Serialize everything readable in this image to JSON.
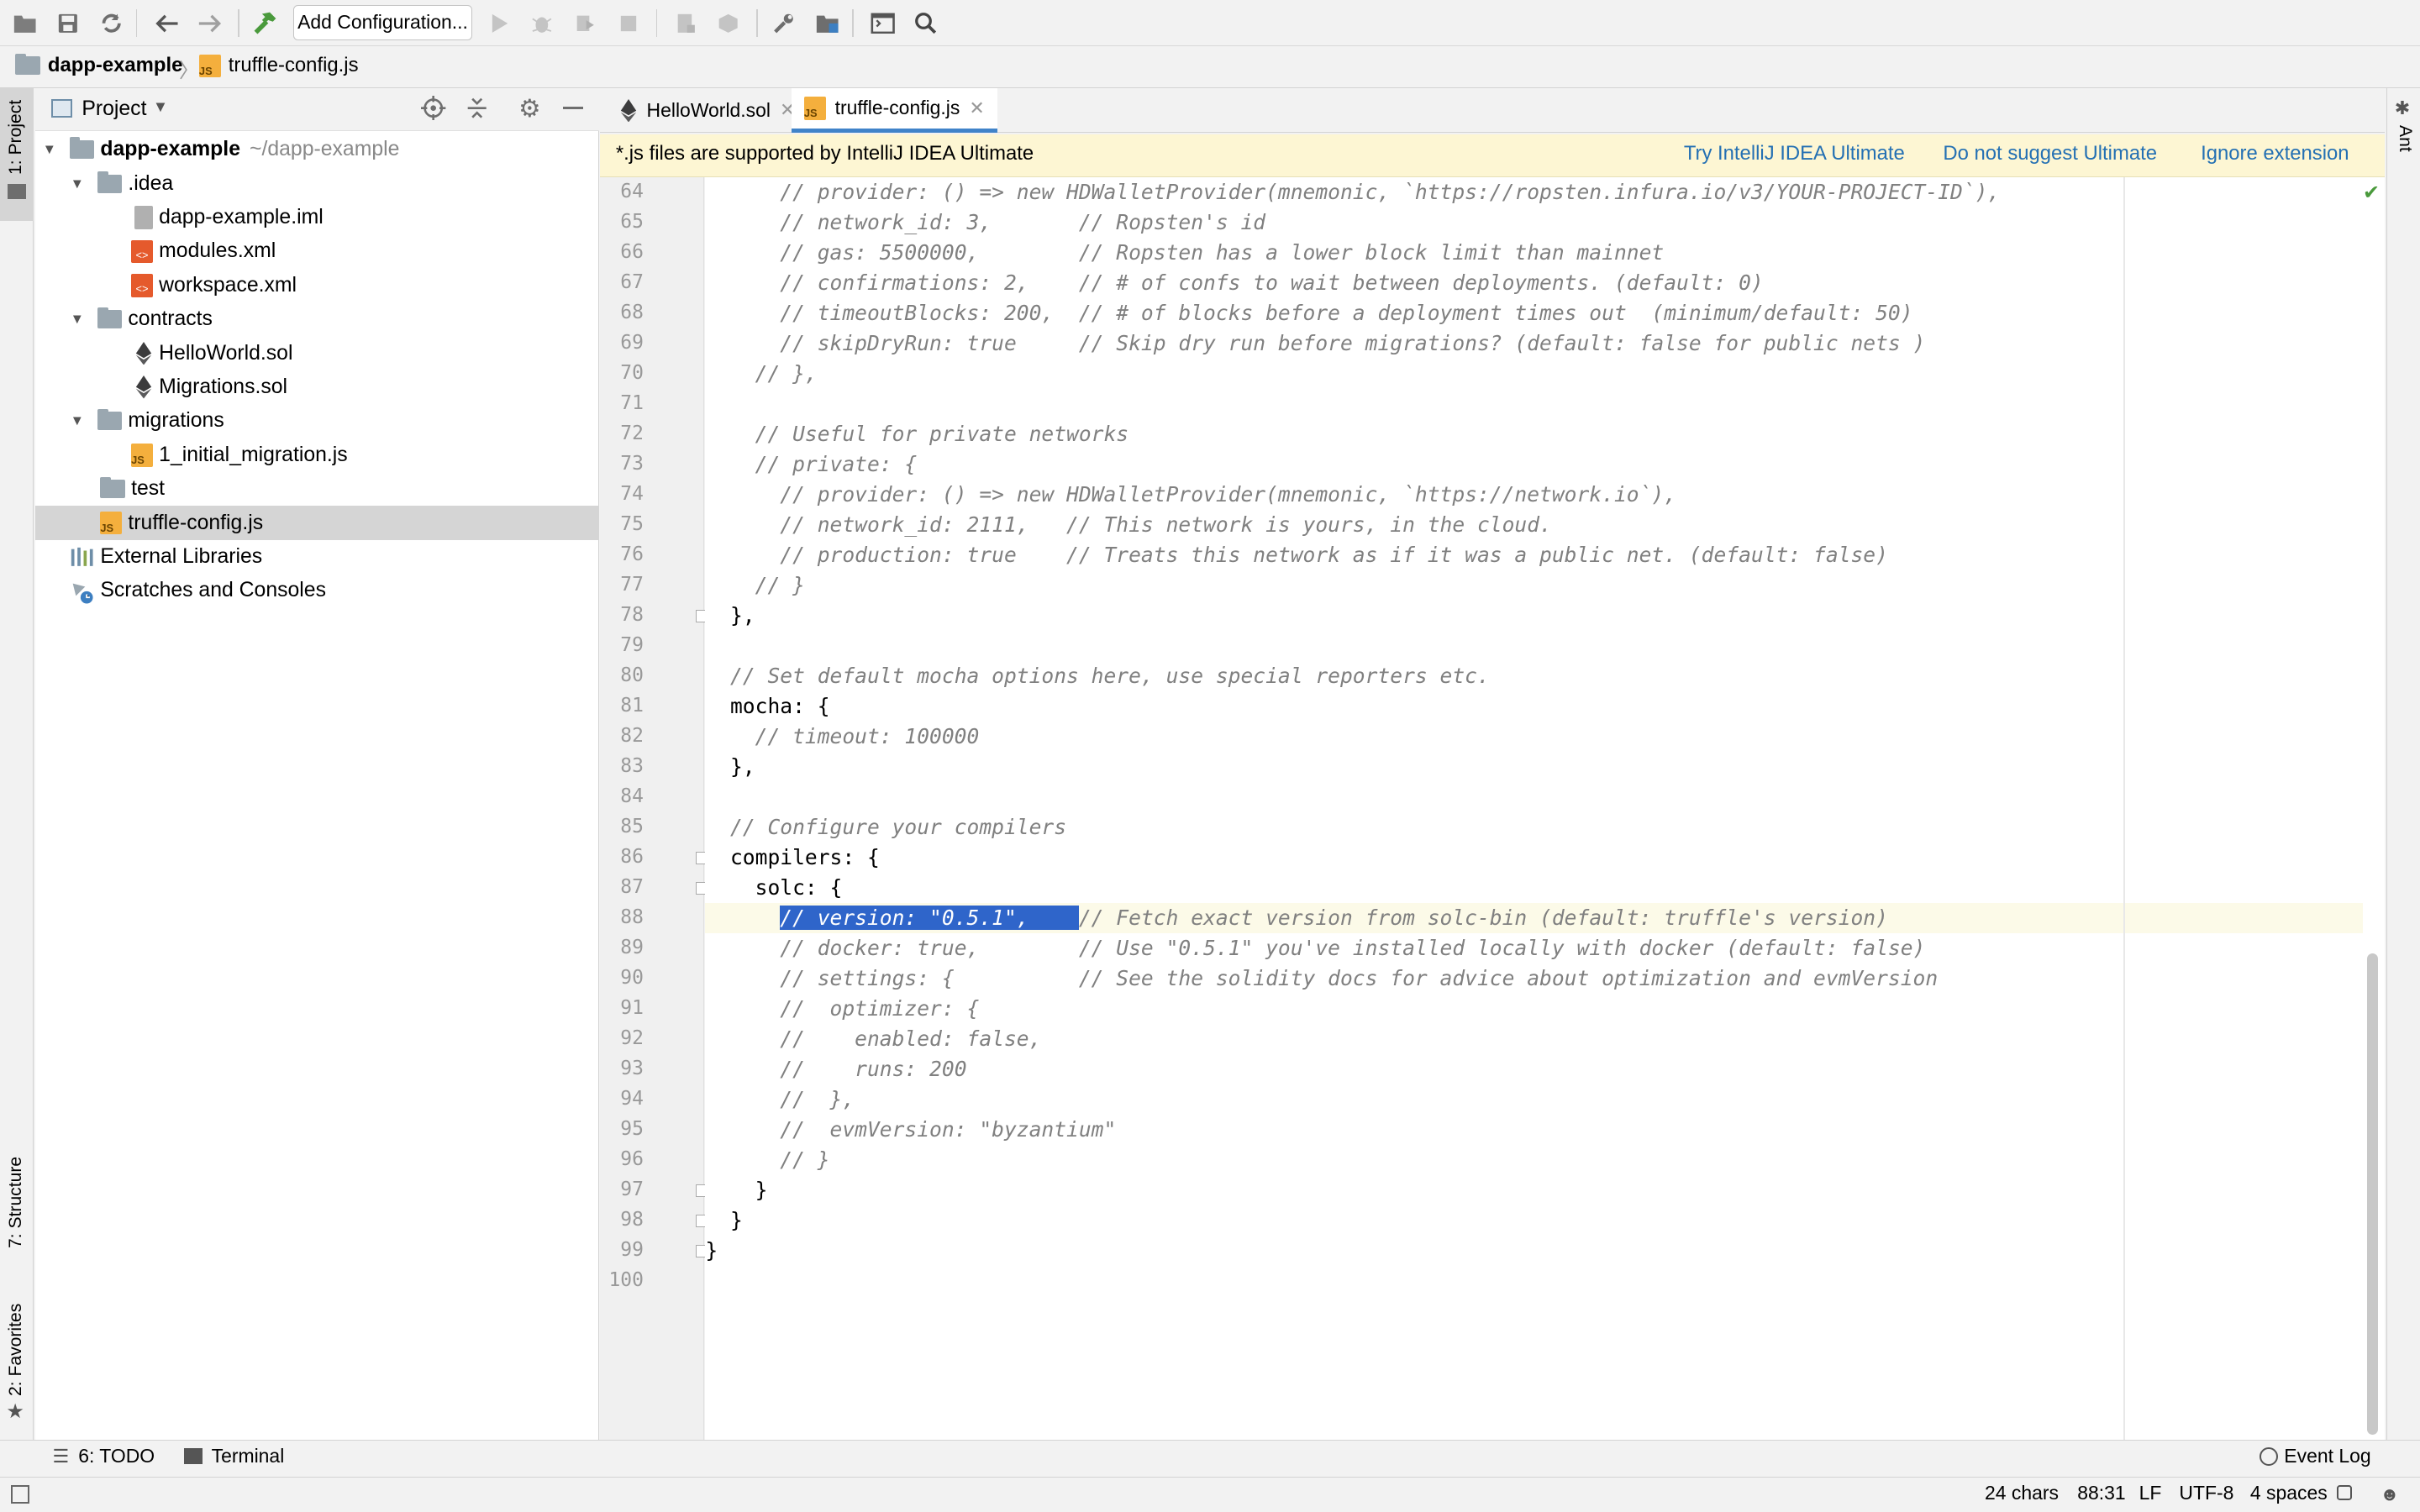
{
  "toolbar": {
    "add_config_label": "Add Configuration..."
  },
  "breadcrumb": {
    "project": "dapp-example",
    "file": "truffle-config.js"
  },
  "stripes": {
    "project": "1: Project",
    "structure": "7: Structure",
    "favorites": "2: Favorites",
    "ant": "Ant"
  },
  "project_panel": {
    "title": "Project",
    "tree": [
      {
        "label": "dapp-example",
        "suffix": "~/dapp-example",
        "kind": "root-folder",
        "expanded": true,
        "depth": 0
      },
      {
        "label": ".idea",
        "kind": "folder",
        "expanded": true,
        "depth": 1
      },
      {
        "label": "dapp-example.iml",
        "kind": "iml",
        "depth": 2
      },
      {
        "label": "modules.xml",
        "kind": "xml",
        "depth": 2
      },
      {
        "label": "workspace.xml",
        "kind": "xml",
        "depth": 2
      },
      {
        "label": "contracts",
        "kind": "folder",
        "expanded": true,
        "depth": 1
      },
      {
        "label": "HelloWorld.sol",
        "kind": "sol",
        "depth": 2
      },
      {
        "label": "Migrations.sol",
        "kind": "sol",
        "depth": 2
      },
      {
        "label": "migrations",
        "kind": "folder",
        "expanded": true,
        "depth": 1
      },
      {
        "label": "1_initial_migration.js",
        "kind": "js",
        "depth": 2
      },
      {
        "label": "test",
        "kind": "folder",
        "expanded": false,
        "depth": 1
      },
      {
        "label": "truffle-config.js",
        "kind": "js",
        "depth": 1,
        "selected": true
      },
      {
        "label": "External Libraries",
        "kind": "libs",
        "depth": 0
      },
      {
        "label": "Scratches and Consoles",
        "kind": "scratches",
        "depth": 0
      }
    ]
  },
  "editor_tabs": [
    {
      "label": "HelloWorld.sol",
      "active": false
    },
    {
      "label": "truffle-config.js",
      "active": true
    }
  ],
  "banner": {
    "message": "*.js files are supported by IntelliJ IDEA Ultimate",
    "try_link": "Try IntelliJ IDEA Ultimate",
    "dont_suggest_link": "Do not suggest Ultimate",
    "ignore_link": "Ignore extension"
  },
  "code": {
    "current_line": 88,
    "lines": [
      {
        "n": "64",
        "text": "      // provider: () => new HDWalletProvider(mnemonic, `https://ropsten.infura.io/v3/YOUR-PROJECT-ID`),"
      },
      {
        "n": "65",
        "text": "      // network_id: 3,       // Ropsten's id"
      },
      {
        "n": "66",
        "text": "      // gas: 5500000,        // Ropsten has a lower block limit than mainnet"
      },
      {
        "n": "67",
        "text": "      // confirmations: 2,    // # of confs to wait between deployments. (default: 0)"
      },
      {
        "n": "68",
        "text": "      // timeoutBlocks: 200,  // # of blocks before a deployment times out  (minimum/default: 50)"
      },
      {
        "n": "69",
        "text": "      // skipDryRun: true     // Skip dry run before migrations? (default: false for public nets )"
      },
      {
        "n": "70",
        "text": "    // },"
      },
      {
        "n": "71",
        "text": ""
      },
      {
        "n": "72",
        "text": "    // Useful for private networks"
      },
      {
        "n": "73",
        "text": "    // private: {"
      },
      {
        "n": "74",
        "text": "      // provider: () => new HDWalletProvider(mnemonic, `https://network.io`),"
      },
      {
        "n": "75",
        "text": "      // network_id: 2111,   // This network is yours, in the cloud."
      },
      {
        "n": "76",
        "text": "      // production: true    // Treats this network as if it was a public net. (default: false)"
      },
      {
        "n": "77",
        "text": "    // }"
      },
      {
        "n": "78",
        "text": "  },"
      },
      {
        "n": "79",
        "text": ""
      },
      {
        "n": "80",
        "text": "  // Set default mocha options here, use special reporters etc."
      },
      {
        "n": "81",
        "text": "  mocha: {"
      },
      {
        "n": "82",
        "text": "    // timeout: 100000"
      },
      {
        "n": "83",
        "text": "  },"
      },
      {
        "n": "84",
        "text": ""
      },
      {
        "n": "85",
        "text": "  // Configure your compilers"
      },
      {
        "n": "86",
        "text": "  compilers: {"
      },
      {
        "n": "87",
        "text": "    solc: {"
      },
      {
        "n": "88",
        "text": "      // version: \"0.5.1\",    // Fetch exact version from solc-bin (default: truffle's version)"
      },
      {
        "n": "89",
        "text": "      // docker: true,        // Use \"0.5.1\" you've installed locally with docker (default: false)"
      },
      {
        "n": "90",
        "text": "      // settings: {          // See the solidity docs for advice about optimization and evmVersion"
      },
      {
        "n": "91",
        "text": "      //  optimizer: {"
      },
      {
        "n": "92",
        "text": "      //    enabled: false,"
      },
      {
        "n": "93",
        "text": "      //    runs: 200"
      },
      {
        "n": "94",
        "text": "      //  },"
      },
      {
        "n": "95",
        "text": "      //  evmVersion: \"byzantium\""
      },
      {
        "n": "96",
        "text": "      // }"
      },
      {
        "n": "97",
        "text": "    }"
      },
      {
        "n": "98",
        "text": "  }"
      },
      {
        "n": "99",
        "text": "}"
      },
      {
        "n": "100",
        "text": ""
      }
    ],
    "selection_text": "// version: \"0.5.1\",    "
  },
  "bottom_tools": {
    "todo": "6: TODO",
    "terminal": "Terminal",
    "event_log": "Event Log"
  },
  "status_bar": {
    "chars": "24 chars",
    "position": "88:31",
    "line_sep": "LF",
    "encoding": "UTF-8",
    "indent": "4 spaces"
  },
  "colors": {
    "selection": "#2f65ca",
    "link": "#2470b3",
    "banner_bg": "#fdf6d3",
    "comment": "#808080"
  }
}
